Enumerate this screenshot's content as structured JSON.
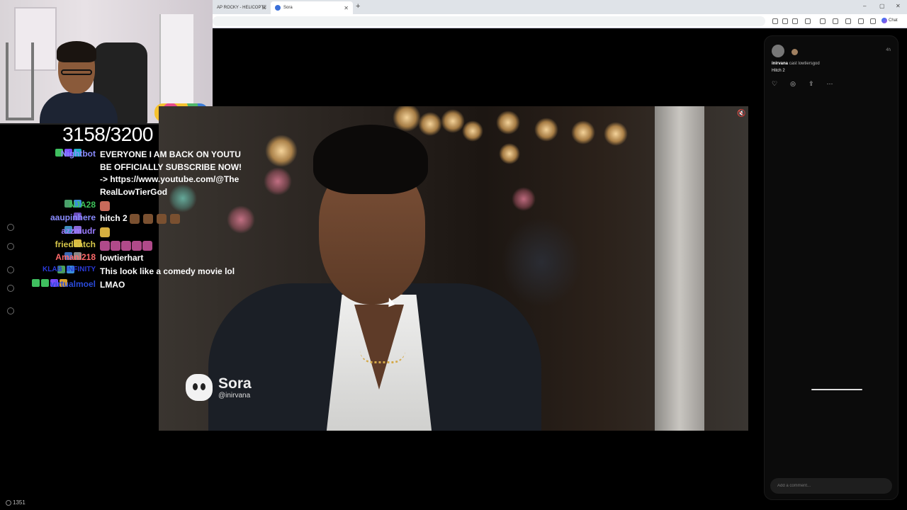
{
  "browser": {
    "tabs": [
      {
        "label": "AP ROCKY - HELICOPTE"
      },
      {
        "label": "Sora"
      }
    ],
    "new_tab": "+",
    "chat_button": "Chat",
    "window_controls": [
      "–",
      "▢",
      "✕"
    ]
  },
  "stream": {
    "counter": "3158/3200",
    "viewers": "1351"
  },
  "chat": {
    "messages": [
      {
        "user": "Nightbot",
        "user_color": "#8a8cff",
        "text": "EVERYONE I AM BACK ON YOUTUBE OFFICIALLY SUBSCRIBE NOW! -> https://www.youtube.com/@TheRealLowTierGod",
        "badges": [
          "#3fbf5f",
          "#7a4cff",
          "#1fb0c8"
        ]
      },
      {
        "user": "NJA28",
        "user_color": "#3ec45a",
        "text": "",
        "emote": "#c96a5a",
        "badges": [
          "#4a9f6a",
          "#3a8fd8"
        ]
      },
      {
        "user": "aaupinhere",
        "user_color": "#8a8cff",
        "text": "hitch 2",
        "emote_count": 4,
        "emote": "#7a5030",
        "badges": [
          "#6a4cb8"
        ]
      },
      {
        "user": "azzmudr",
        "user_color": "#9a7cff",
        "text": "",
        "emote": "#d8b040",
        "badges": [
          "#3f8fbf",
          "#8a6ad8"
        ]
      },
      {
        "user": "friedsatch",
        "user_color": "#d8c84a",
        "text": "",
        "emote_count": 5,
        "emote": "#b04a8a",
        "badges": [
          "#d8b840"
        ]
      },
      {
        "user": "Amani218",
        "user_color": "#ff6a6a",
        "text": "lowtierhart",
        "badges": [
          "#3a6ab8",
          "#888888"
        ]
      },
      {
        "user": "KLAB_INFINITY",
        "user_color": "#2a3ad8",
        "text": "This look like a comedy movie lol",
        "badges": [
          "#4aa05a",
          "#3a8fd8"
        ]
      },
      {
        "user": "virtualmoel",
        "user_color": "#2a4ad8",
        "text": "LMAO",
        "badges": [
          "#3fbf5f",
          "#3fbf5f",
          "#7a4cff",
          "#d8a030"
        ]
      }
    ]
  },
  "video": {
    "brand": "Sora",
    "handle": "@inirvana"
  },
  "panel": {
    "time": "4h",
    "author": "inirvana",
    "cast_text": "cast lowtiersgod",
    "title": "Hitch 2",
    "actions": [
      "heart-icon",
      "remix-icon",
      "share-icon",
      "more-icon"
    ],
    "comment_placeholder": "Add a comment..."
  }
}
